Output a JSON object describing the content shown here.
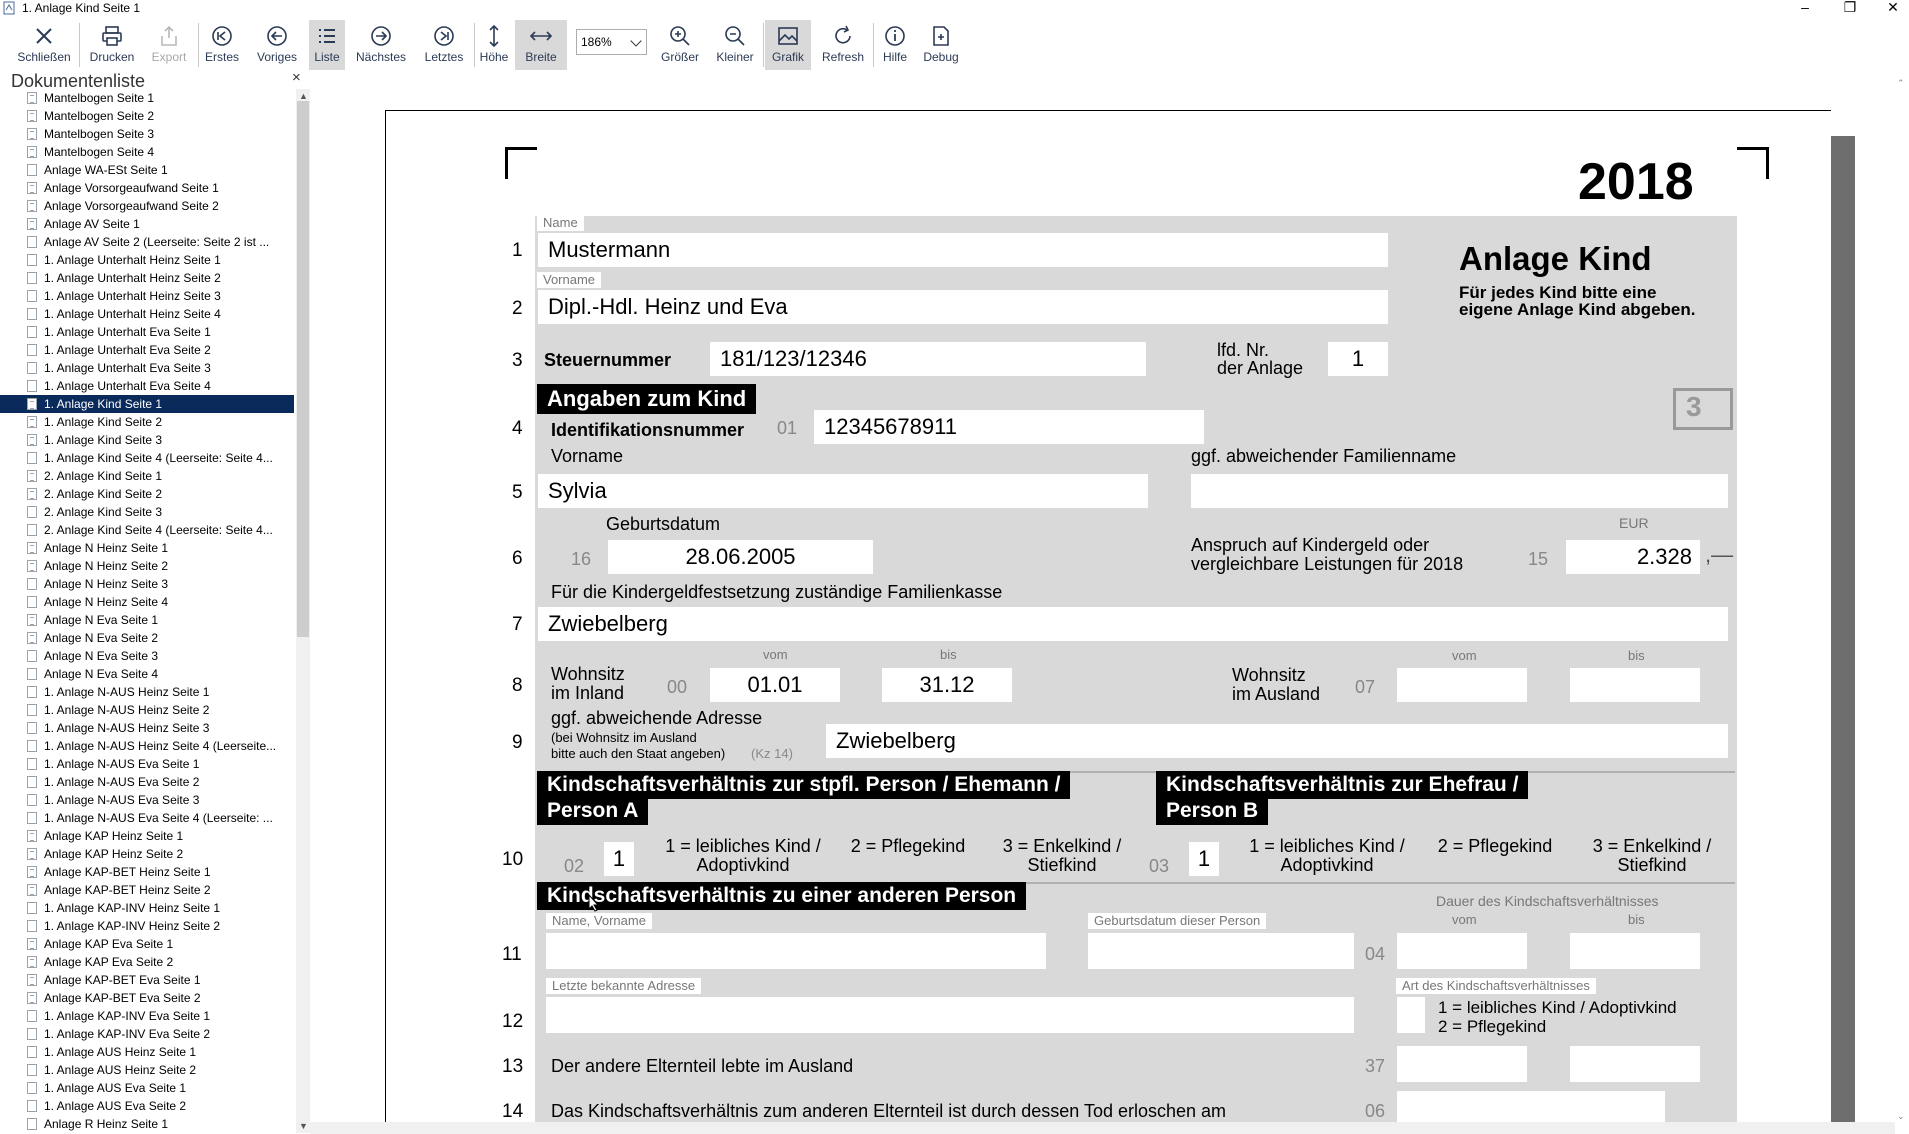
{
  "window": {
    "title": "1. Anlage Kind Seite 1"
  },
  "toolbar": {
    "buttons": [
      {
        "label": "Schließen",
        "icon": "close-icon"
      },
      {
        "label": "Drucken",
        "icon": "printer-icon"
      },
      {
        "label": "Export",
        "icon": "export-icon"
      },
      {
        "label": "Erstes",
        "icon": "first-page-icon"
      },
      {
        "label": "Voriges",
        "icon": "previous-page-icon"
      },
      {
        "label": "Liste",
        "icon": "list-icon"
      },
      {
        "label": "Nächstes",
        "icon": "next-page-icon"
      },
      {
        "label": "Letztes",
        "icon": "last-page-icon"
      },
      {
        "label": "Höhe",
        "icon": "fit-height-icon"
      },
      {
        "label": "Breite",
        "icon": "fit-width-icon"
      },
      {
        "label": "Größer",
        "icon": "zoom-in-icon"
      },
      {
        "label": "Kleiner",
        "icon": "zoom-out-icon"
      },
      {
        "label": "Grafik",
        "icon": "image-icon"
      },
      {
        "label": "Refresh",
        "icon": "refresh-icon"
      },
      {
        "label": "Hilfe",
        "icon": "info-icon"
      },
      {
        "label": "Debug",
        "icon": "debug-icon"
      }
    ],
    "zoom": "186%"
  },
  "doclist": {
    "title": "Dokumentenliste",
    "items": [
      "Mantelbogen Seite 1",
      "Mantelbogen Seite 2",
      "Mantelbogen Seite 3",
      "Mantelbogen Seite 4",
      "Anlage WA-ESt Seite 1",
      "Anlage Vorsorgeaufwand Seite 1",
      "Anlage Vorsorgeaufwand Seite 2",
      "Anlage AV Seite 1",
      "Anlage AV Seite 2 (Leerseite: Seite 2 ist ...",
      "1. Anlage Unterhalt Heinz Seite 1",
      "1. Anlage Unterhalt Heinz Seite 2",
      "1. Anlage Unterhalt Heinz Seite 3",
      "1. Anlage Unterhalt Heinz Seite 4",
      "1. Anlage Unterhalt Eva Seite 1",
      "1. Anlage Unterhalt Eva Seite 2",
      "1. Anlage Unterhalt Eva Seite 3",
      "1. Anlage Unterhalt Eva Seite 4",
      "1. Anlage Kind Seite 1",
      "1. Anlage Kind Seite 2",
      "1. Anlage Kind Seite 3",
      "1. Anlage Kind Seite 4 (Leerseite: Seite 4...",
      "2. Anlage Kind Seite 1",
      "2. Anlage Kind Seite 2",
      "2. Anlage Kind Seite 3",
      "2. Anlage Kind Seite 4 (Leerseite: Seite 4...",
      "Anlage N Heinz Seite 1",
      "Anlage N Heinz Seite 2",
      "Anlage N Heinz Seite 3",
      "Anlage N Heinz Seite 4",
      "Anlage N Eva Seite 1",
      "Anlage N Eva Seite 2",
      "Anlage N Eva Seite 3",
      "Anlage N Eva Seite 4",
      "1. Anlage N-AUS Heinz Seite 1",
      "1. Anlage N-AUS Heinz Seite 2",
      "1. Anlage N-AUS Heinz Seite 3",
      "1. Anlage N-AUS Heinz Seite 4 (Leerseite...",
      "1. Anlage N-AUS Eva Seite 1",
      "1. Anlage N-AUS Eva Seite 2",
      "1. Anlage N-AUS Eva Seite 3",
      "1. Anlage N-AUS Eva Seite 4 (Leerseite: ...",
      "Anlage KAP Heinz Seite 1",
      "Anlage KAP Heinz Seite 2",
      "Anlage KAP-BET Heinz Seite 1",
      "Anlage KAP-BET Heinz Seite 2",
      "1. Anlage KAP-INV Heinz Seite 1",
      "1. Anlage KAP-INV Heinz Seite 2",
      "Anlage KAP Eva Seite 1",
      "Anlage KAP Eva Seite 2",
      "Anlage KAP-BET Eva Seite 1",
      "Anlage KAP-BET Eva Seite 2",
      "1. Anlage KAP-INV Eva Seite 1",
      "1. Anlage KAP-INV Eva Seite 2",
      "1. Anlage AUS Heinz Seite 1",
      "1. Anlage AUS Heinz Seite 2",
      "1. Anlage AUS Eva Seite 1",
      "1. Anlage AUS Eva Seite 2",
      "Anlage R Heinz Seite 1"
    ],
    "selected_index": 17,
    "lined_icons": [
      0,
      1,
      2,
      3,
      5,
      6,
      7,
      17,
      18,
      19,
      21,
      22,
      25,
      26,
      29,
      30,
      41,
      42,
      43,
      44,
      47,
      48,
      49,
      50
    ]
  },
  "form": {
    "year": "2018",
    "title": "Anlage Kind",
    "subtitle1": "Für jedes Kind bitte eine",
    "subtitle2": "eigene Anlage Kind abgeben.",
    "box_number": "3",
    "lines": [
      "1",
      "2",
      "3",
      "4",
      "5",
      "6",
      "7",
      "8",
      "9",
      "10",
      "11",
      "12",
      "13",
      "14"
    ],
    "name_tag": "Name",
    "name": "Mustermann",
    "vorname_tag": "Vorname",
    "vorname": "Dipl.-Hdl. Heinz und Eva",
    "steuernummer_label": "Steuernummer",
    "steuernummer": "181/123/12346",
    "lfd_label1": "lfd. Nr.",
    "lfd_label2": "der Anlage",
    "lfd": "1",
    "section1": "Angaben zum Kind",
    "id_label": "Identifikationsnummer",
    "id_kz": "01",
    "id": "12345678911",
    "kind_vorname_label": "Vorname",
    "kind_vorname": "Sylvia",
    "familienname_label": "ggf. abweichender Familienname",
    "geburtsdatum_label": "Geburtsdatum",
    "geburtsdatum_kz": "16",
    "geburtsdatum": "28.06.2005",
    "anspruch_label1": "Anspruch auf Kindergeld oder",
    "anspruch_label2": "vergleichbare Leistungen für 2018",
    "anspruch_kz": "15",
    "eur": "EUR",
    "anspruch": "2.328",
    "anspruch_suffix": ",—",
    "familienkasse_label": "Für die Kindergeldfestsetzung zuständige Familienkasse",
    "familienkasse": "Zwiebelberg",
    "vom": "vom",
    "bis": "bis",
    "wohnsitz_inland1": "Wohnsitz",
    "wohnsitz_inland2": "im Inland",
    "wohnsitz_inland_kz": "00",
    "inland_vom": "01.01",
    "inland_bis": "31.12",
    "wohnsitz_ausland1": "Wohnsitz",
    "wohnsitz_ausland2": "im Ausland",
    "wohnsitz_ausland_kz": "07",
    "adresse_label": "ggf. abweichende Adresse",
    "adresse_note1": "(bei Wohnsitz im Ausland",
    "adresse_note2": "bitte auch den Staat angeben)",
    "adresse_kz": "(Kz 14)",
    "adresse": "Zwiebelberg",
    "section_a1": "Kindschaftsverhältnis zur stpfl. Person / Ehemann /",
    "section_a2": "Person A",
    "section_b1": "Kindschaftsverhältnis zur Ehefrau /",
    "section_b2": "Person B",
    "kz_a": "02",
    "val_a": "1",
    "kz_b": "03",
    "val_b": "1",
    "opt1a": "1 = leibliches Kind /",
    "opt1b": "Adoptivkind",
    "opt2": "2 = Pflegekind",
    "opt3a": "3 = Enkelkind /",
    "opt3b": "Stiefkind",
    "section_c": "Kindschaftsverhältnis zu einer anderen Person",
    "dauer_label": "Dauer des Kindschaftsverhältnisses",
    "name_vorname_tag": "Name, Vorname",
    "geburtsdatum_person_tag": "Geburtsdatum dieser Person",
    "kz_04": "04",
    "letzte_adresse_tag": "Letzte bekannte Adresse",
    "art_tag": "Art des Kindschaftsverhältnisses",
    "art_opt1": "1 = leibliches Kind / Adoptivkind",
    "art_opt2": "2 = Pflegekind",
    "line13_label": "Der andere Elternteil lebte im Ausland",
    "kz_37": "37",
    "line14_label": "Das Kindschaftsverhältnis zum anderen Elternteil ist durch dessen Tod erloschen am",
    "kz_06": "06"
  }
}
